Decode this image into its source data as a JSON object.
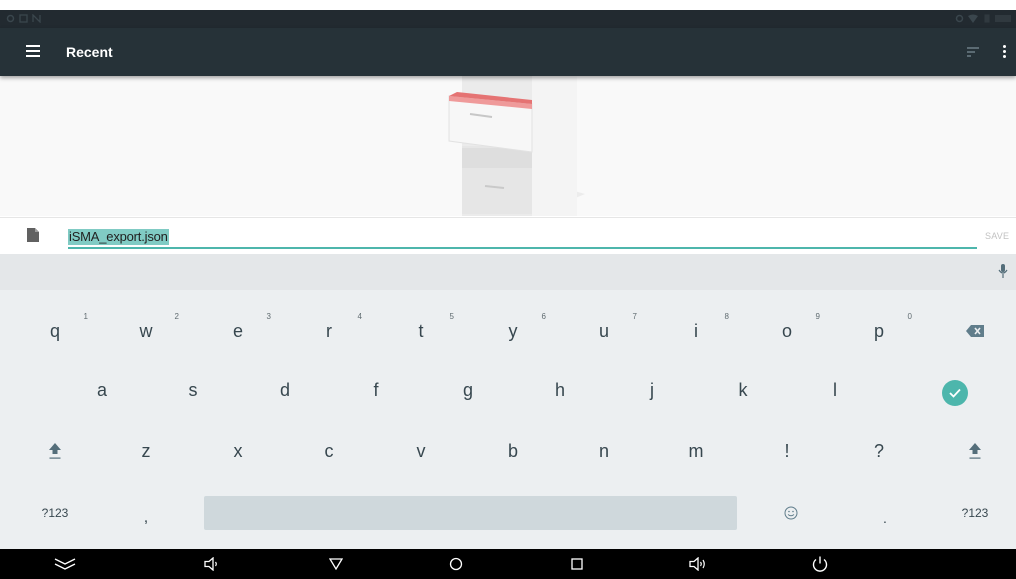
{
  "app": {
    "title": "Recent"
  },
  "icons": {
    "menu": "hamburger-menu-icon",
    "sort": "sort-icon",
    "more": "more-vertical-icon",
    "file": "file-icon",
    "mic": "mic-icon",
    "backspace": "backspace-icon",
    "enter": "check-circle-icon",
    "shift": "shift-icon",
    "emoji": "emoji-icon"
  },
  "colors": {
    "app_bar": "#263238",
    "accent": "#4db6ac",
    "selection": "#80cbc4"
  },
  "save_row": {
    "filename": "iSMA_export.json",
    "save_label": "SAVE"
  },
  "keyboard": {
    "row1": [
      {
        "key": "q",
        "hint": "1"
      },
      {
        "key": "w",
        "hint": "2"
      },
      {
        "key": "e",
        "hint": "3"
      },
      {
        "key": "r",
        "hint": "4"
      },
      {
        "key": "t",
        "hint": "5"
      },
      {
        "key": "y",
        "hint": "6"
      },
      {
        "key": "u",
        "hint": "7"
      },
      {
        "key": "i",
        "hint": "8"
      },
      {
        "key": "o",
        "hint": "9"
      },
      {
        "key": "p",
        "hint": "0"
      }
    ],
    "row2": [
      "a",
      "s",
      "d",
      "f",
      "g",
      "h",
      "j",
      "k",
      "l"
    ],
    "row3": [
      "z",
      "x",
      "c",
      "v",
      "b",
      "n",
      "m",
      "!",
      "?"
    ],
    "row4": {
      "symbols_left": "?123",
      "comma": ",",
      "period": ".",
      "symbols_right": "?123"
    }
  },
  "nav_bar": {
    "buttons": [
      "hide-keyboard",
      "volume-down",
      "back",
      "home",
      "recents",
      "volume-up",
      "power"
    ]
  }
}
